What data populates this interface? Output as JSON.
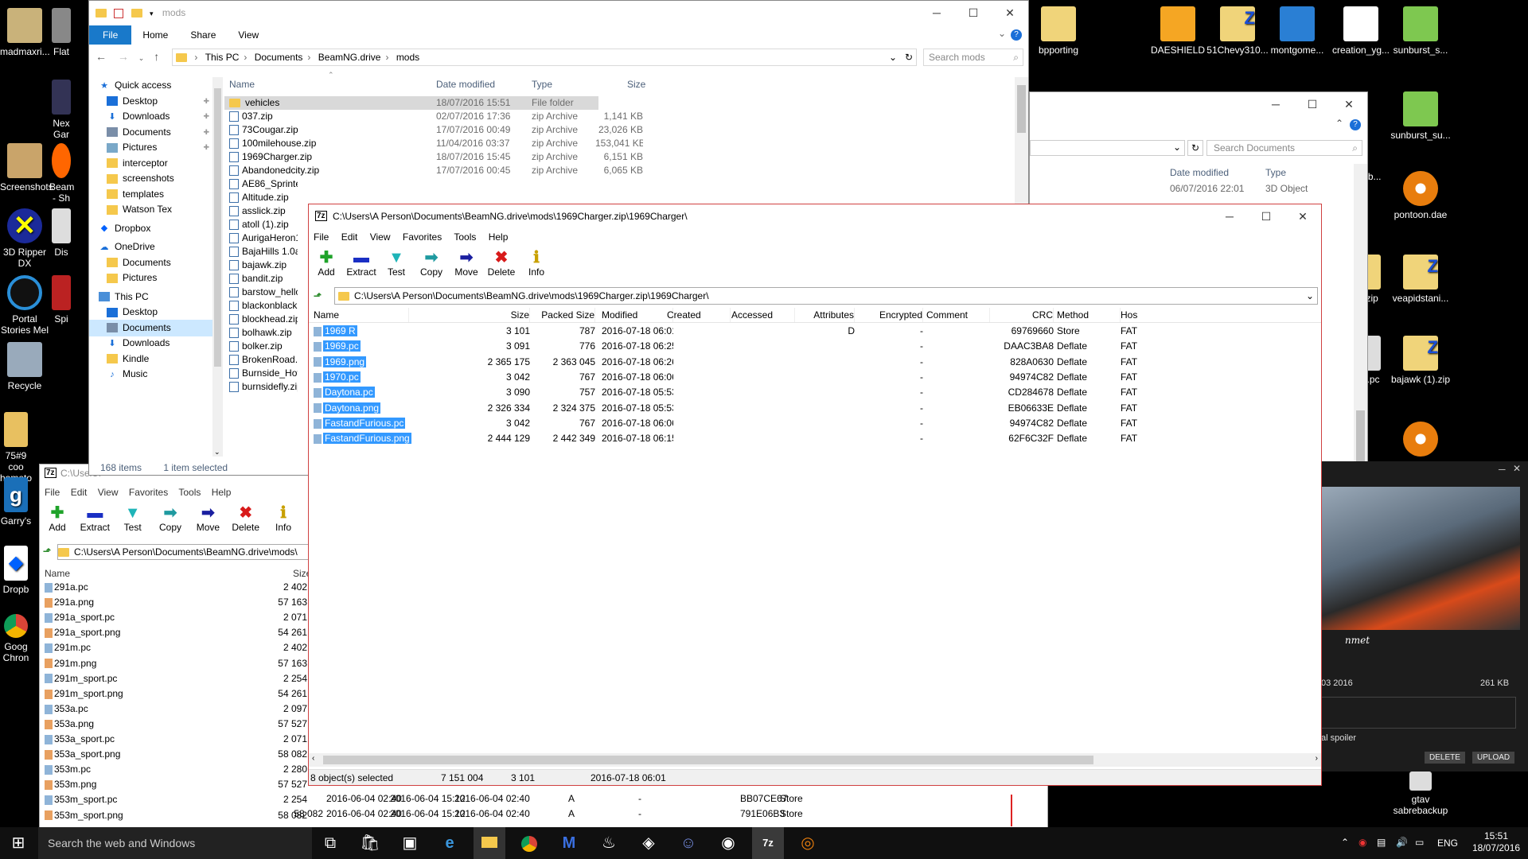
{
  "desktop": {
    "icons_left": [
      "madmaxri...",
      "Flat",
      "Nex Gar",
      "Screenshots",
      "Beam - Sh",
      "3D Ripper DX",
      "Dis",
      "Portal Stories Mel",
      "Spi",
      "Recycle",
      "75#9 coo hometo",
      "Garry's",
      "Dropb",
      "Goog Chron"
    ],
    "icons_top": [
      "bpporting",
      "DAESHIELD",
      "51Chevy310...",
      "montgome...",
      "creation_yg...",
      "sunburst_s..."
    ],
    "icons_right": [
      "sunburst_su...",
      "..jb...",
      "pontoon.dae",
      ".zip",
      "veapidstani...",
      ".l.pc",
      "bajawk (1).zip",
      "gtav sabrebackup"
    ]
  },
  "explorer": {
    "title": "mods",
    "tabs": [
      "File",
      "Home",
      "Share",
      "View"
    ],
    "breadcrumb": [
      "This PC",
      "Documents",
      "BeamNG.drive",
      "mods"
    ],
    "search_placeholder": "Search mods",
    "columns": [
      "Name",
      "Date modified",
      "Type",
      "Size"
    ],
    "nav": [
      {
        "label": "Quick access",
        "type": "star"
      },
      {
        "label": "Desktop",
        "type": "blue"
      },
      {
        "label": "Downloads",
        "type": "down"
      },
      {
        "label": "Documents",
        "type": "doc"
      },
      {
        "label": "Pictures",
        "type": "pic"
      },
      {
        "label": "interceptor",
        "type": "folder"
      },
      {
        "label": "screenshots",
        "type": "folder"
      },
      {
        "label": "templates",
        "type": "folder"
      },
      {
        "label": "Watson Tex",
        "type": "folder"
      },
      {
        "label": "Dropbox",
        "type": "dropbox"
      },
      {
        "label": "OneDrive",
        "type": "cloud"
      },
      {
        "label": "Documents",
        "type": "folder"
      },
      {
        "label": "Pictures",
        "type": "folder"
      },
      {
        "label": "This PC",
        "type": "pc"
      },
      {
        "label": "Desktop",
        "type": "blue"
      },
      {
        "label": "Documents",
        "type": "doc"
      },
      {
        "label": "Downloads",
        "type": "down"
      },
      {
        "label": "Kindle",
        "type": "folder"
      },
      {
        "label": "Music",
        "type": "music"
      }
    ],
    "files": [
      {
        "name": "vehicles",
        "date": "18/07/2016 15:51",
        "type": "File folder",
        "size": ""
      },
      {
        "name": "037.zip",
        "date": "02/07/2016 17:36",
        "type": "zip Archive",
        "size": "1,141 KB"
      },
      {
        "name": "73Cougar.zip",
        "date": "17/07/2016 00:49",
        "type": "zip Archive",
        "size": "23,026 KB"
      },
      {
        "name": "100milehouse.zip",
        "date": "11/04/2016 03:37",
        "type": "zip Archive",
        "size": "153,041 KB"
      },
      {
        "name": "1969Charger.zip",
        "date": "18/07/2016 15:45",
        "type": "zip Archive",
        "size": "6,151 KB"
      },
      {
        "name": "Abandonedcity.zip",
        "date": "17/07/2016 00:45",
        "type": "zip Archive",
        "size": "6,065 KB"
      },
      {
        "name": "AE86_Sprinter_",
        "date": "",
        "type": "",
        "size": ""
      },
      {
        "name": "Altitude.zip",
        "date": "",
        "type": "",
        "size": ""
      },
      {
        "name": "asslick.zip",
        "date": "",
        "type": "",
        "size": ""
      },
      {
        "name": "atoll (1).zip",
        "date": "",
        "type": "",
        "size": ""
      },
      {
        "name": "AurigaHeron19",
        "date": "",
        "type": "",
        "size": ""
      },
      {
        "name": "BajaHills 1.0a.zi",
        "date": "",
        "type": "",
        "size": ""
      },
      {
        "name": "bajawk.zip",
        "date": "",
        "type": "",
        "size": ""
      },
      {
        "name": "bandit.zip",
        "date": "",
        "type": "",
        "size": ""
      },
      {
        "name": "barstow_hellca",
        "date": "",
        "type": "",
        "size": ""
      },
      {
        "name": "blackonblack.z",
        "date": "",
        "type": "",
        "size": ""
      },
      {
        "name": "blockhead.zip",
        "date": "",
        "type": "",
        "size": ""
      },
      {
        "name": "bolhawk.zip",
        "date": "",
        "type": "",
        "size": ""
      },
      {
        "name": "bolker.zip",
        "date": "",
        "type": "",
        "size": ""
      },
      {
        "name": "BrokenRoad.zip",
        "date": "",
        "type": "",
        "size": ""
      },
      {
        "name": "Burnside_Hot_",
        "date": "",
        "type": "",
        "size": ""
      },
      {
        "name": "burnsidefly.zip",
        "date": "",
        "type": "",
        "size": ""
      }
    ],
    "status_items": "168 items",
    "status_selected": "1 item selected"
  },
  "explorer2": {
    "search_placeholder": "Search Documents",
    "col_date": "Date modified",
    "col_type": "Type",
    "row_date": "06/07/2016 22:01",
    "row_type": "3D Object"
  },
  "zip_main": {
    "title": "C:\\Users\\A Person\\Documents\\BeamNG.drive\\mods\\1969Charger.zip\\1969Charger\\",
    "menu": [
      "File",
      "Edit",
      "View",
      "Favorites",
      "Tools",
      "Help"
    ],
    "tools": [
      {
        "label": "Add",
        "glyph": "✚",
        "color": "#1fa32a"
      },
      {
        "label": "Extract",
        "glyph": "▬",
        "color": "#1a2fc4"
      },
      {
        "label": "Test",
        "glyph": "▼",
        "color": "#1fb4b8"
      },
      {
        "label": "Copy",
        "glyph": "➡",
        "color": "#1f9aa0"
      },
      {
        "label": "Move",
        "glyph": "➡",
        "color": "#1a1fa0"
      },
      {
        "label": "Delete",
        "glyph": "✖",
        "color": "#d81a1a"
      },
      {
        "label": "Info",
        "glyph": "ℹ",
        "color": "#c8a000"
      }
    ],
    "path": "C:\\Users\\A Person\\Documents\\BeamNG.drive\\mods\\1969Charger.zip\\1969Charger\\",
    "columns": [
      "Name",
      "Size",
      "Packed Size",
      "Modified",
      "Created",
      "Accessed",
      "Attributes",
      "Encrypted",
      "Comment",
      "CRC",
      "Method",
      "Hos"
    ],
    "rows": [
      {
        "name": "1969 R",
        "size": "3 101",
        "packed": "787",
        "modified": "2016-07-18 06:01",
        "attr": "D",
        "enc": "-",
        "crc": "69769660",
        "method": "Store",
        "host": "FAT"
      },
      {
        "name": "1969.pc",
        "size": "3 091",
        "packed": "776",
        "modified": "2016-07-18 06:25",
        "attr": "",
        "enc": "-",
        "crc": "DAAC3BA8",
        "method": "Deflate",
        "host": "FAT"
      },
      {
        "name": "1969.png",
        "size": "2 365 175",
        "packed": "2 363 045",
        "modified": "2016-07-18 06:26",
        "attr": "",
        "enc": "-",
        "crc": "828A0630",
        "method": "Deflate",
        "host": "FAT"
      },
      {
        "name": "1970.pc",
        "size": "3 042",
        "packed": "767",
        "modified": "2016-07-18 06:06",
        "attr": "",
        "enc": "-",
        "crc": "94974C82",
        "method": "Deflate",
        "host": "FAT"
      },
      {
        "name": "Daytona.pc",
        "size": "3 090",
        "packed": "757",
        "modified": "2016-07-18 05:53",
        "attr": "",
        "enc": "-",
        "crc": "CD284678",
        "method": "Deflate",
        "host": "FAT"
      },
      {
        "name": "Daytona.png",
        "size": "2 326 334",
        "packed": "2 324 375",
        "modified": "2016-07-18 05:53",
        "attr": "",
        "enc": "-",
        "crc": "EB06633E",
        "method": "Deflate",
        "host": "FAT"
      },
      {
        "name": "FastandFurious.pc",
        "size": "3 042",
        "packed": "767",
        "modified": "2016-07-18 06:06",
        "attr": "",
        "enc": "-",
        "crc": "94974C82",
        "method": "Deflate",
        "host": "FAT"
      },
      {
        "name": "FastandFurious.png",
        "size": "2 444 129",
        "packed": "2 442 349",
        "modified": "2016-07-18 06:15",
        "attr": "",
        "enc": "-",
        "crc": "62F6C32F",
        "method": "Deflate",
        "host": "FAT"
      }
    ],
    "status": [
      "8 object(s) selected",
      "7 151 004",
      "3 101",
      "2016-07-18 06:01"
    ]
  },
  "zip_back": {
    "title": "C:\\Users\\",
    "menu": [
      "File",
      "Edit",
      "View",
      "Favorites",
      "Tools",
      "Help"
    ],
    "path": "C:\\Users\\A Person\\Documents\\BeamNG.drive\\mods\\",
    "columns": [
      "Name",
      "Size"
    ],
    "rows": [
      {
        "name": "291a.pc",
        "size": "2 402"
      },
      {
        "name": "291a.png",
        "size": "57 163"
      },
      {
        "name": "291a_sport.pc",
        "size": "2 071"
      },
      {
        "name": "291a_sport.png",
        "size": "54 261"
      },
      {
        "name": "291m.pc",
        "size": "2 402"
      },
      {
        "name": "291m.png",
        "size": "57 163"
      },
      {
        "name": "291m_sport.pc",
        "size": "2 254"
      },
      {
        "name": "291m_sport.png",
        "size": "54 261"
      },
      {
        "name": "353a.pc",
        "size": "2 097"
      },
      {
        "name": "353a.png",
        "size": "57 527"
      },
      {
        "name": "353a_sport.pc",
        "size": "2 071"
      },
      {
        "name": "353a_sport.png",
        "size": "58 082"
      },
      {
        "name": "353m.pc",
        "size": "2 280"
      },
      {
        "name": "353m.png",
        "size": "57 527"
      },
      {
        "name": "353m_sport.pc",
        "size": "2 254"
      },
      {
        "name": "353m_sport.png",
        "size": "58 082"
      }
    ],
    "extra_rows": [
      {
        "c1": "2016-06-04 02:40",
        "c2": "2016-06-04 15:12",
        "c3": "2016-06-04 02:40",
        "attr": "A",
        "enc": "-",
        "crc": "BB07CE67",
        "method": "Store"
      },
      {
        "c1": "2016-06-04 02:40",
        "c2": "2016-06-04 15:12",
        "c3": "2016-06-04 02:40",
        "attr": "A",
        "enc": "-",
        "crc": "791E06B3",
        "method": "Store"
      }
    ],
    "packed_2": "58 082"
  },
  "photo_panel": {
    "date": "03 2016",
    "size": "261 KB",
    "spoiler": "al spoiler",
    "delete": "DELETE",
    "upload": "UPLOAD",
    "caption": "nmet"
  },
  "taskbar": {
    "search": "Search the web and Windows",
    "lang": "ENG",
    "time": "15:51",
    "date": "18/07/2016"
  }
}
